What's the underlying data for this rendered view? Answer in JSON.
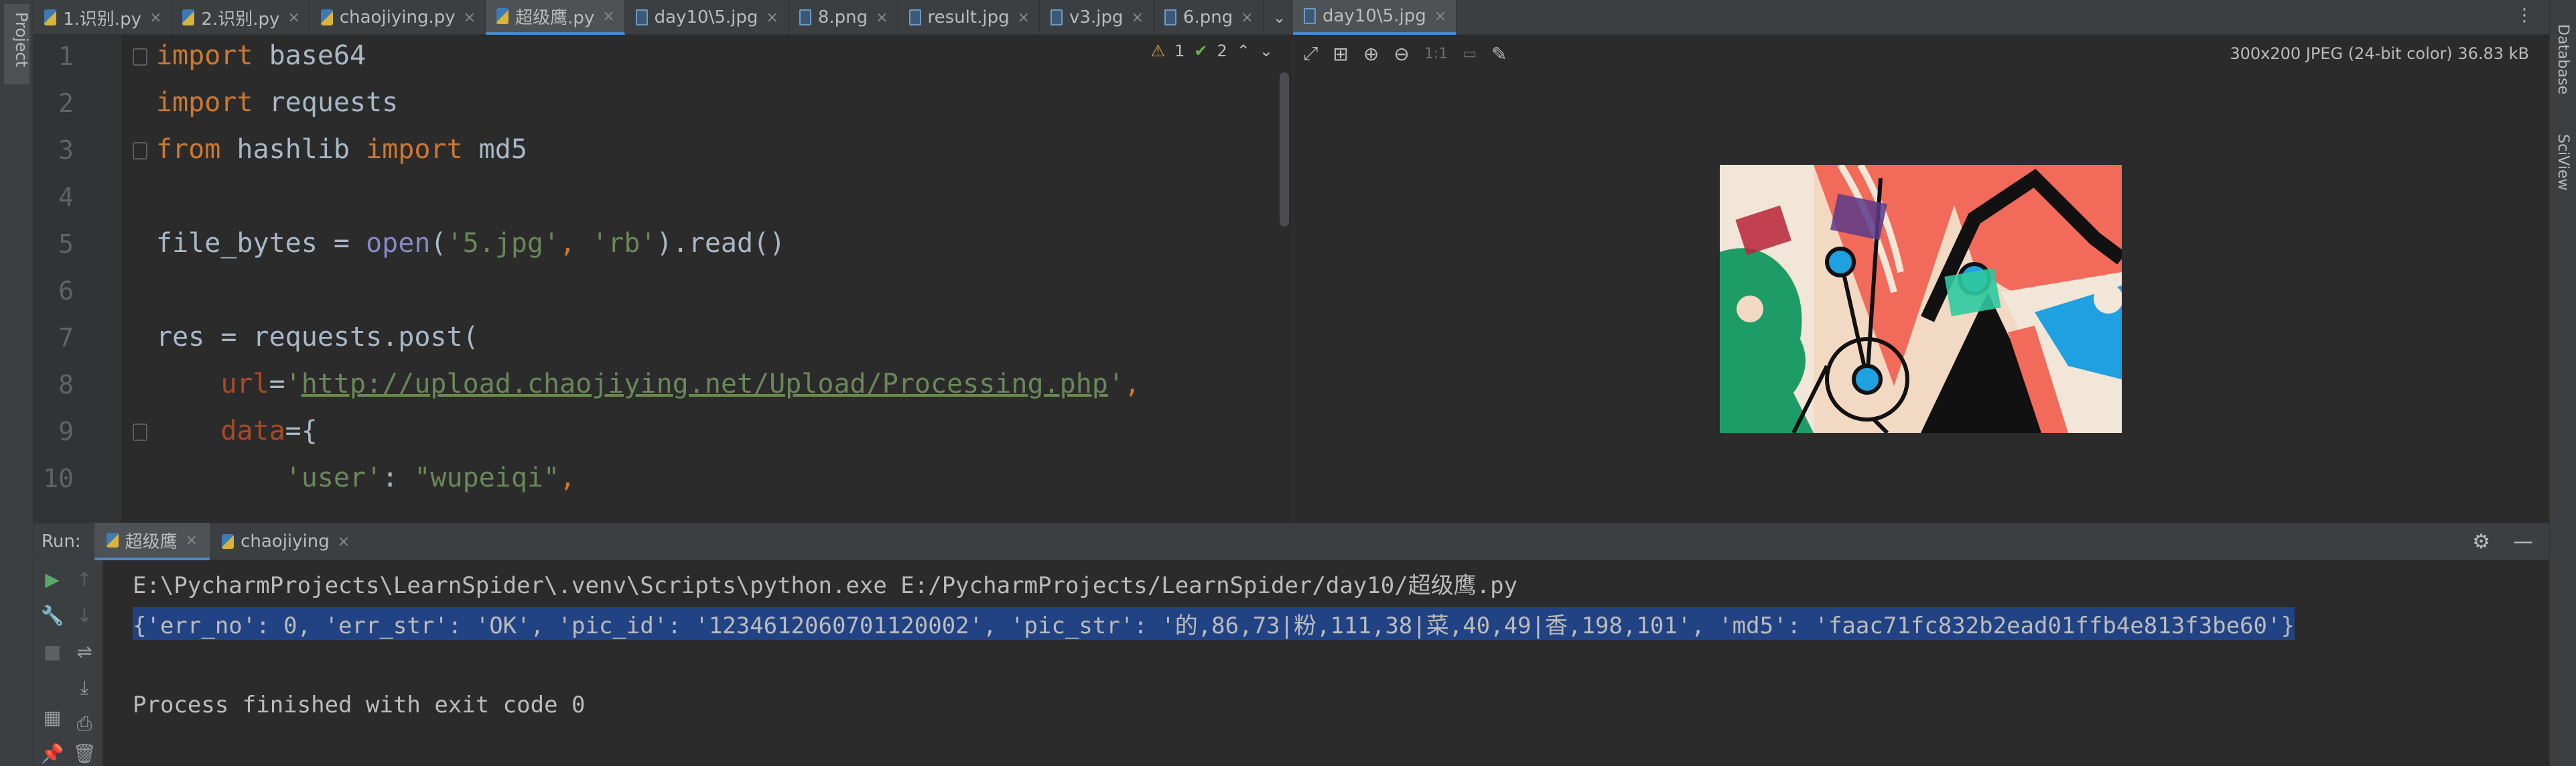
{
  "left_strip": {
    "project_label": "Project"
  },
  "right_strip": {
    "database_label": "Database",
    "sciview_label": "SciView"
  },
  "editor_tabs": [
    {
      "label": "1.识别.py",
      "kind": "py"
    },
    {
      "label": "2.识别.py",
      "kind": "py"
    },
    {
      "label": "chaojiying.py",
      "kind": "py"
    },
    {
      "label": "超级鹰.py",
      "kind": "py",
      "active": true
    },
    {
      "label": "day10\\5.jpg",
      "kind": "img"
    },
    {
      "label": "8.png",
      "kind": "img"
    },
    {
      "label": "result.jpg",
      "kind": "img"
    },
    {
      "label": "v3.jpg",
      "kind": "img"
    },
    {
      "label": "6.png",
      "kind": "img"
    }
  ],
  "image_tab": {
    "label": "day10\\5.jpg"
  },
  "inspections": {
    "warnings": "1",
    "weak_warnings": "2"
  },
  "code": {
    "line_numbers": [
      "1",
      "2",
      "3",
      "4",
      "5",
      "6",
      "7",
      "8",
      "9",
      "10"
    ]
  },
  "viewer": {
    "info": "300x200 JPEG (24-bit color) 36.83 kB",
    "zoom_ratio": "1:1"
  },
  "run": {
    "label": "Run:",
    "tabs": [
      {
        "label": "超级鹰",
        "active": true
      },
      {
        "label": "chaojiying"
      }
    ]
  },
  "console": {
    "cmd": "E:\\PycharmProjects\\LearnSpider\\.venv\\Scripts\\python.exe E:/PycharmProjects/LearnSpider/day10/超级鹰.py",
    "result": "{'err_no': 0, 'err_str': 'OK', 'pic_id': '1234612060701120002', 'pic_str': '的,86,73|粉,111,38|菜,40,49|香,198,101', 'md5': 'faac71fc832b2ead01ffb4e813f3be60'}",
    "finish": "Process finished with exit code 0"
  },
  "colors": {
    "keyword": "#cc7832",
    "string": "#6a8759",
    "builtin": "#8888c6",
    "param": "#aa4926",
    "selection": "#214283",
    "tab_underline": "#4a88c7"
  }
}
